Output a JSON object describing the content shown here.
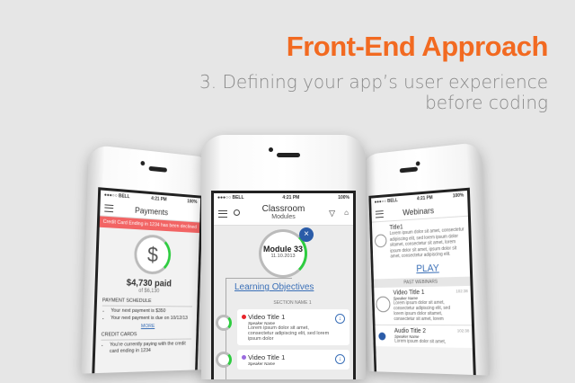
{
  "headline": {
    "title": "Front-End Approach",
    "subtitle_line1": "3. Defining your app’s user experience",
    "subtitle_line2": "before coding"
  },
  "status": {
    "carrier": "●●●○○ BELL",
    "time": "4:21 PM",
    "battery": "100%"
  },
  "payments": {
    "title": "Payments",
    "alert": "Credit Card Ending in 1234 has been declined",
    "icon": "dollar-icon",
    "paid": "$4,730 paid",
    "of": "of $6,130",
    "schedule_heading": "PAYMENT SCHEDULE",
    "schedule_items": [
      "Your next payment is $350",
      "Your next payment is due on 10/12/13"
    ],
    "more": "MORE",
    "cards_heading": "CREDIT CARDS",
    "cards_item": "You're currently paying with the credit card ending in 1234",
    "alert_color": "#f26464"
  },
  "classroom": {
    "title": "Classroom",
    "subtitle": "Modules",
    "module": "Module 33",
    "date": "11.10.2013",
    "objectives": "Learning Objectives",
    "section": "SECTION NAME 1",
    "videos": [
      {
        "title": "Video Title 1",
        "speaker": "Speaker Name",
        "body": "Lorem ipsum dolor sit amet, consectetur adipiscing elit, sed lorem ipsum dolor",
        "dot": "#e8242b"
      },
      {
        "title": "Video Title 1",
        "speaker": "Speaker Name",
        "body": "",
        "dot": "#9b6bde"
      }
    ]
  },
  "webinars": {
    "title": "Webinars",
    "item_title": "Title1",
    "item_body": "Lorem ipsum dolor sit amet, consectetur adipiscing elit, sed lorem ipsum dolor sitamet, consectetur sit amet, lorem ipsum dolor sit amet, ipsum dolor sit amet, consectetur adipiscing elit.",
    "play": "PLAY",
    "past": "PAST WEBINARS",
    "past_items": [
      {
        "title": "Video Title 1",
        "speaker": "Speaker Name",
        "body": "Lorem ipsum dolor sit amet, consectetur adipiscing elit, sed lorem ipsum dolor sitamet, consectetur sit amet, lorem",
        "time": "102:38"
      },
      {
        "title": "Audio Title 2",
        "speaker": "Speaker Name",
        "body": "Lorem ipsum dolor sit amet,",
        "time": "102:38"
      }
    ]
  }
}
